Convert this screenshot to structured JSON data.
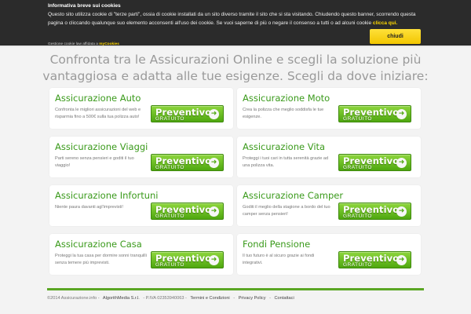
{
  "cookie": {
    "title": "Informativa breve sui cookies",
    "text_before": "Questo sito utilizza cookie di \"terze parti\", ossia di cookie installati da un sito diverso tramite il sito che si sta visitando. Chiudendo questo banner, scorrendo questa pagina o cliccando qualunque suo elemento acconsenti all'uso dei cookie. Se vuoi saperne di più o negare il consenso a tutti o ad alcuni cookie ",
    "link": "clicca qui.",
    "close_label": "chiudi",
    "powered_prefix": "Gestione cookie law affidata a",
    "powered_brand": "myCookies"
  },
  "hero": {
    "line1": "Confronta tra le Assicurazioni Online e scegli la soluzione più",
    "line2": "vantaggiosa e adatta alle tue esigenze. Scegli da dove iniziare:"
  },
  "button": {
    "line1": "Preventivo",
    "line2": "GRATUITO",
    "arrow": "➜"
  },
  "cards": [
    {
      "title": "Assicurazione Auto",
      "desc": "Confronta le migliori assicurazioni del web e risparmia fino a 500€ sulla tua polizza auto!"
    },
    {
      "title": "Assicurazione Moto",
      "desc": "Crea la polizza che meglio soddisfa le tue esigenze."
    },
    {
      "title": "Assicurazione Viaggi",
      "desc": "Parti sereno senza pensieri e goditi il tuo viaggio!"
    },
    {
      "title": "Assicurazione Vita",
      "desc": "Proteggi i tuoi cari in tutta serenità grazie ad una polizza vita."
    },
    {
      "title": "Assicurazione Infortuni",
      "desc": "Niente paura davanti agl'imprevisti!"
    },
    {
      "title": "Assicurazione Camper",
      "desc": "Goditi il meglio della stagione a bordo del tuo camper senza pensieri!"
    },
    {
      "title": "Assicurazione Casa",
      "desc": "Proteggi la tua casa per dormire sonni tranquilli senza temere più imprevisti."
    },
    {
      "title": "Fondi Pensione",
      "desc": "Il tuo futuro è al sicuro grazie ai fondi integrativi."
    }
  ],
  "footer": {
    "copyright": "©2014 Assicurazione.info -",
    "company": "AlgorithMedia S.r.l.",
    "vat": "- P.IVA 02353940063 -",
    "terms": "Termini e Condizioni",
    "sep1": "-",
    "privacy": "Privacy Policy",
    "sep2": "-",
    "contacts": "Contattaci"
  },
  "colors": {
    "accent_green": "#3a9a1b",
    "button_green": "#5fb51f",
    "banner_bg": "#212121",
    "banner_button": "#ffd800"
  }
}
